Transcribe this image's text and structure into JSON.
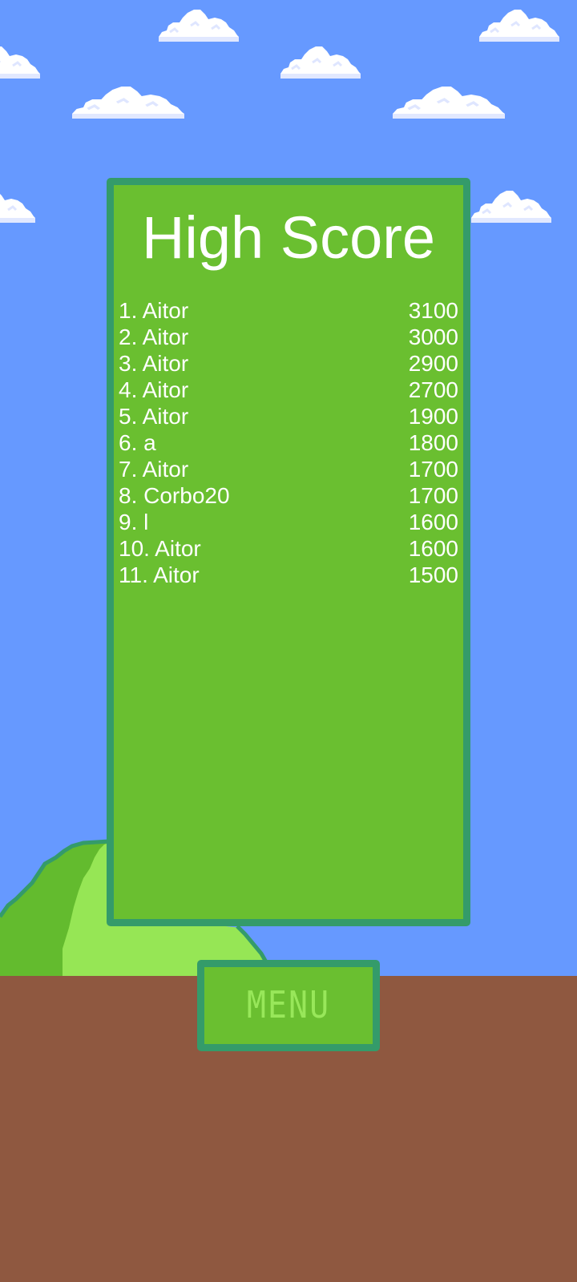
{
  "colors": {
    "sky": "#6699ff",
    "ground": "#8f5840",
    "panel_fill": "#6abf30",
    "panel_border": "#349b6a",
    "hill_dark": "#63bb2e",
    "hill_light": "#96e655",
    "menu_text": "#98e75a"
  },
  "high_score": {
    "title": "High Score",
    "entries": [
      {
        "rank": "1.",
        "name": "Aitor",
        "score": "3100"
      },
      {
        "rank": "2.",
        "name": "Aitor",
        "score": "3000"
      },
      {
        "rank": "3.",
        "name": "Aitor",
        "score": "2900"
      },
      {
        "rank": "4.",
        "name": "Aitor",
        "score": "2700"
      },
      {
        "rank": "5.",
        "name": "Aitor",
        "score": "1900"
      },
      {
        "rank": "6.",
        "name": "a",
        "score": "1800"
      },
      {
        "rank": "7.",
        "name": "Aitor",
        "score": "1700"
      },
      {
        "rank": "8.",
        "name": "Corbo20",
        "score": "1700"
      },
      {
        "rank": "9.",
        "name": "l",
        "score": "1600"
      },
      {
        "rank": "10.",
        "name": "Aitor",
        "score": "1600"
      },
      {
        "rank": "11.",
        "name": "Aitor",
        "score": "1500"
      }
    ]
  },
  "menu_button": {
    "label": "MENU"
  }
}
